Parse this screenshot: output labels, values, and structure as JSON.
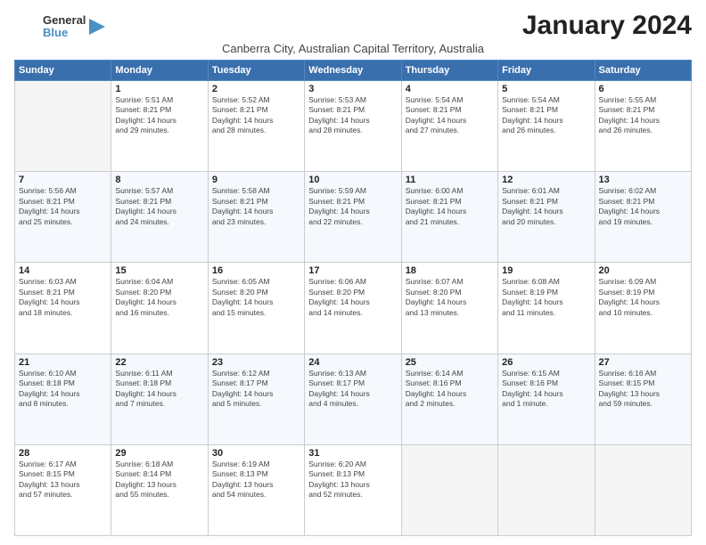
{
  "logo": {
    "general": "General",
    "blue": "Blue"
  },
  "title": "January 2024",
  "subtitle": "Canberra City, Australian Capital Territory, Australia",
  "headers": [
    "Sunday",
    "Monday",
    "Tuesday",
    "Wednesday",
    "Thursday",
    "Friday",
    "Saturday"
  ],
  "rows": [
    [
      {
        "day": "",
        "info": ""
      },
      {
        "day": "1",
        "info": "Sunrise: 5:51 AM\nSunset: 8:21 PM\nDaylight: 14 hours\nand 29 minutes."
      },
      {
        "day": "2",
        "info": "Sunrise: 5:52 AM\nSunset: 8:21 PM\nDaylight: 14 hours\nand 28 minutes."
      },
      {
        "day": "3",
        "info": "Sunrise: 5:53 AM\nSunset: 8:21 PM\nDaylight: 14 hours\nand 28 minutes."
      },
      {
        "day": "4",
        "info": "Sunrise: 5:54 AM\nSunset: 8:21 PM\nDaylight: 14 hours\nand 27 minutes."
      },
      {
        "day": "5",
        "info": "Sunrise: 5:54 AM\nSunset: 8:21 PM\nDaylight: 14 hours\nand 26 minutes."
      },
      {
        "day": "6",
        "info": "Sunrise: 5:55 AM\nSunset: 8:21 PM\nDaylight: 14 hours\nand 26 minutes."
      }
    ],
    [
      {
        "day": "7",
        "info": "Sunrise: 5:56 AM\nSunset: 8:21 PM\nDaylight: 14 hours\nand 25 minutes."
      },
      {
        "day": "8",
        "info": "Sunrise: 5:57 AM\nSunset: 8:21 PM\nDaylight: 14 hours\nand 24 minutes."
      },
      {
        "day": "9",
        "info": "Sunrise: 5:58 AM\nSunset: 8:21 PM\nDaylight: 14 hours\nand 23 minutes."
      },
      {
        "day": "10",
        "info": "Sunrise: 5:59 AM\nSunset: 8:21 PM\nDaylight: 14 hours\nand 22 minutes."
      },
      {
        "day": "11",
        "info": "Sunrise: 6:00 AM\nSunset: 8:21 PM\nDaylight: 14 hours\nand 21 minutes."
      },
      {
        "day": "12",
        "info": "Sunrise: 6:01 AM\nSunset: 8:21 PM\nDaylight: 14 hours\nand 20 minutes."
      },
      {
        "day": "13",
        "info": "Sunrise: 6:02 AM\nSunset: 8:21 PM\nDaylight: 14 hours\nand 19 minutes."
      }
    ],
    [
      {
        "day": "14",
        "info": "Sunrise: 6:03 AM\nSunset: 8:21 PM\nDaylight: 14 hours\nand 18 minutes."
      },
      {
        "day": "15",
        "info": "Sunrise: 6:04 AM\nSunset: 8:20 PM\nDaylight: 14 hours\nand 16 minutes."
      },
      {
        "day": "16",
        "info": "Sunrise: 6:05 AM\nSunset: 8:20 PM\nDaylight: 14 hours\nand 15 minutes."
      },
      {
        "day": "17",
        "info": "Sunrise: 6:06 AM\nSunset: 8:20 PM\nDaylight: 14 hours\nand 14 minutes."
      },
      {
        "day": "18",
        "info": "Sunrise: 6:07 AM\nSunset: 8:20 PM\nDaylight: 14 hours\nand 13 minutes."
      },
      {
        "day": "19",
        "info": "Sunrise: 6:08 AM\nSunset: 8:19 PM\nDaylight: 14 hours\nand 11 minutes."
      },
      {
        "day": "20",
        "info": "Sunrise: 6:09 AM\nSunset: 8:19 PM\nDaylight: 14 hours\nand 10 minutes."
      }
    ],
    [
      {
        "day": "21",
        "info": "Sunrise: 6:10 AM\nSunset: 8:18 PM\nDaylight: 14 hours\nand 8 minutes."
      },
      {
        "day": "22",
        "info": "Sunrise: 6:11 AM\nSunset: 8:18 PM\nDaylight: 14 hours\nand 7 minutes."
      },
      {
        "day": "23",
        "info": "Sunrise: 6:12 AM\nSunset: 8:17 PM\nDaylight: 14 hours\nand 5 minutes."
      },
      {
        "day": "24",
        "info": "Sunrise: 6:13 AM\nSunset: 8:17 PM\nDaylight: 14 hours\nand 4 minutes."
      },
      {
        "day": "25",
        "info": "Sunrise: 6:14 AM\nSunset: 8:16 PM\nDaylight: 14 hours\nand 2 minutes."
      },
      {
        "day": "26",
        "info": "Sunrise: 6:15 AM\nSunset: 8:16 PM\nDaylight: 14 hours\nand 1 minute."
      },
      {
        "day": "27",
        "info": "Sunrise: 6:16 AM\nSunset: 8:15 PM\nDaylight: 13 hours\nand 59 minutes."
      }
    ],
    [
      {
        "day": "28",
        "info": "Sunrise: 6:17 AM\nSunset: 8:15 PM\nDaylight: 13 hours\nand 57 minutes."
      },
      {
        "day": "29",
        "info": "Sunrise: 6:18 AM\nSunset: 8:14 PM\nDaylight: 13 hours\nand 55 minutes."
      },
      {
        "day": "30",
        "info": "Sunrise: 6:19 AM\nSunset: 8:13 PM\nDaylight: 13 hours\nand 54 minutes."
      },
      {
        "day": "31",
        "info": "Sunrise: 6:20 AM\nSunset: 8:13 PM\nDaylight: 13 hours\nand 52 minutes."
      },
      {
        "day": "",
        "info": ""
      },
      {
        "day": "",
        "info": ""
      },
      {
        "day": "",
        "info": ""
      }
    ]
  ]
}
